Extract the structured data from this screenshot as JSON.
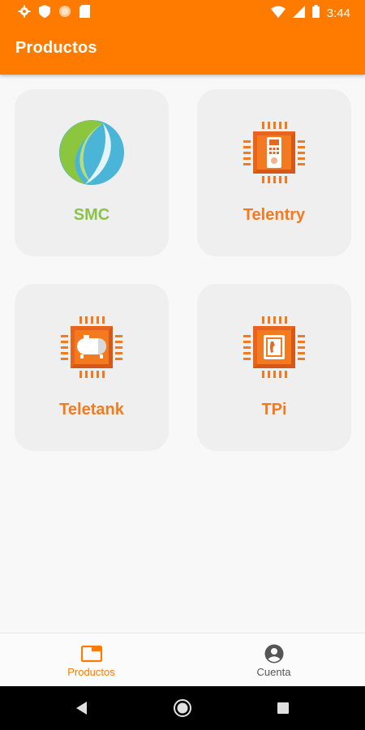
{
  "status_bar": {
    "time": "3:44",
    "icons": [
      "gear-icon",
      "shield-icon",
      "circle-icon",
      "sd-card-icon",
      "wifi-icon",
      "signal-icon",
      "battery-icon"
    ]
  },
  "app_bar": {
    "title": "Productos"
  },
  "products": [
    {
      "label": "SMC",
      "color": "#8bc34a",
      "icon": "leaf-globe-icon"
    },
    {
      "label": "Telentry",
      "color": "#f47a1f",
      "icon": "chip-intercom-icon"
    },
    {
      "label": "Teletank",
      "color": "#f47a1f",
      "icon": "chip-tank-icon"
    },
    {
      "label": "TPi",
      "color": "#f47a1f",
      "icon": "chip-phone-icon"
    }
  ],
  "bottom_nav": {
    "items": [
      {
        "label": "Productos",
        "icon": "folder-icon",
        "active": true
      },
      {
        "label": "Cuenta",
        "icon": "account-icon",
        "active": false
      }
    ],
    "active_color": "#ff7b00",
    "inactive_color": "#555555"
  },
  "system_nav": [
    "back-icon",
    "home-icon",
    "recents-icon"
  ]
}
